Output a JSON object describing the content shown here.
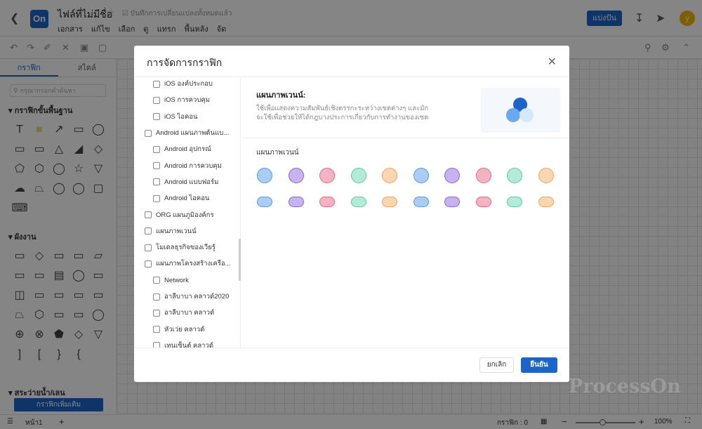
{
  "header": {
    "logo": "On",
    "file_name": "ไฟล์ที่ไม่มีชื่อ",
    "save_status": "บันทึกการเปลี่ยนแปลงทั้งหมดแล้ว",
    "menus": [
      "เอกสาร",
      "แก้ไข",
      "เลือก",
      "ดู",
      "แทรก",
      "พื้นหลัง",
      "จัด"
    ],
    "share_label": "แบ่งปัน",
    "avatar_letter": "y"
  },
  "sidebar": {
    "tabs": [
      "กราฟิก",
      "สไตล์"
    ],
    "search_placeholder": "กรุณากรอกคำค้นหา",
    "section_basic": "กราฟิกขั้นพื้นฐาน",
    "section_flow": "ผังงาน",
    "section_proto": "สระว่ายน้ำ/เลน",
    "add_graphics_label": "กราฟิกเพิ่มเติม"
  },
  "statusbar": {
    "page_tab": "หน้า1",
    "graphics_count_label": "กราฟิก : 0",
    "zoom": "100%"
  },
  "watermark": "ProcessOn",
  "modal": {
    "title": "การจัดการกราฟิก",
    "tree": [
      {
        "label": "iOS องค์ประกอบ",
        "indent": true
      },
      {
        "label": "iOS การควบคุม",
        "indent": true
      },
      {
        "label": "iOS ไอคอน",
        "indent": true
      },
      {
        "label": "Android แผนภาพต้นแบ...",
        "indent": false
      },
      {
        "label": "Android อุปกรณ์",
        "indent": true
      },
      {
        "label": "Android การควบคุม",
        "indent": true
      },
      {
        "label": "Android แบบฟอร์ม",
        "indent": true
      },
      {
        "label": "Android ไอคอน",
        "indent": true
      },
      {
        "label": "ORG แผนภูมิองค์กร",
        "indent": false
      },
      {
        "label": "แผนภาพเวนน์",
        "indent": false
      },
      {
        "label": "โมเดลธุรกิจของเวียรู้",
        "indent": false
      },
      {
        "label": "แผนภาพโครงสร้างเครือ...",
        "indent": false
      },
      {
        "label": "Network",
        "indent": true
      },
      {
        "label": "อาลีบาบา คลาวด์2020",
        "indent": true
      },
      {
        "label": "อาลีบาบา คลาวด์",
        "indent": true
      },
      {
        "label": "หัวเว่ย คลาวด์",
        "indent": true
      },
      {
        "label": "เทนเซ็นต์ คลาวด์",
        "indent": true
      }
    ],
    "detail_title": "แผนภาพเวนน์:",
    "detail_desc": "ใช้เพื่อแสดงความสัมพันธ์เชิงตรรกะระหว่างเซตต่างๆ และมักจะใช้เพื่อช่วยให้ได้กฎบางประการเกี่ยวกับการทำงานของเซต",
    "shapes_heading": "แผนภาพเวนน์",
    "circle_colors": [
      {
        "fill": "#a9cdf3",
        "stroke": "#5a98e0"
      },
      {
        "fill": "#c8b3f0",
        "stroke": "#8b63d8"
      },
      {
        "fill": "#f4b3c3",
        "stroke": "#e06a86"
      },
      {
        "fill": "#b2ecd8",
        "stroke": "#5cc9a4"
      },
      {
        "fill": "#fbd6b2",
        "stroke": "#f0a660"
      },
      {
        "fill": "#a9cdf3",
        "stroke": "#5a98e0"
      },
      {
        "fill": "#c8b3f0",
        "stroke": "#8b63d8"
      },
      {
        "fill": "#f4b3c3",
        "stroke": "#e06a86"
      },
      {
        "fill": "#b2ecd8",
        "stroke": "#5cc9a4"
      },
      {
        "fill": "#fbd6b2",
        "stroke": "#f0a660"
      }
    ],
    "cancel_label": "ยกเลิก",
    "confirm_label": "ยืนยัน"
  }
}
